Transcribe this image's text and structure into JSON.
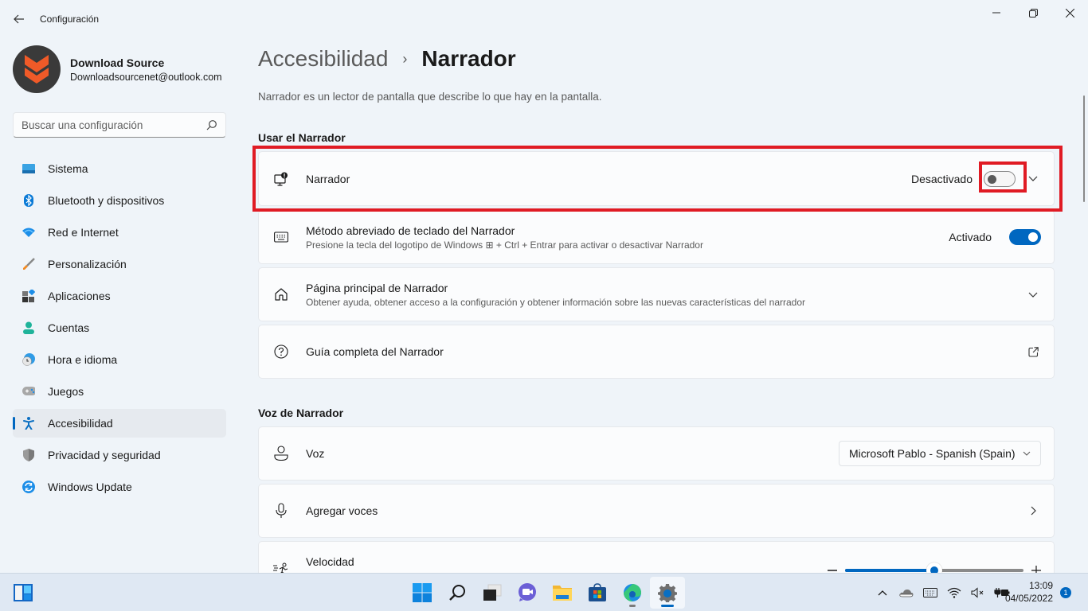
{
  "window": {
    "app_title": "Configuración",
    "icons": {
      "back": "arrow-left-icon",
      "minimize": "minimize-icon",
      "maximize": "restore-icon",
      "close": "close-icon"
    }
  },
  "profile": {
    "name": "Download Source",
    "email": "Downloadsourcenet@outlook.com"
  },
  "search": {
    "placeholder": "Buscar una configuración",
    "value": ""
  },
  "sidebar": {
    "items": [
      {
        "label": "Sistema",
        "icon": "system-display-icon",
        "active": false
      },
      {
        "label": "Bluetooth y dispositivos",
        "icon": "bluetooth-icon",
        "active": false
      },
      {
        "label": "Red e Internet",
        "icon": "wifi-icon",
        "active": false
      },
      {
        "label": "Personalización",
        "icon": "paintbrush-icon",
        "active": false
      },
      {
        "label": "Aplicaciones",
        "icon": "apps-icon",
        "active": false
      },
      {
        "label": "Cuentas",
        "icon": "account-icon",
        "active": false
      },
      {
        "label": "Hora e idioma",
        "icon": "time-language-icon",
        "active": false
      },
      {
        "label": "Juegos",
        "icon": "gamepad-icon",
        "active": false
      },
      {
        "label": "Accesibilidad",
        "icon": "accessibility-icon",
        "active": true
      },
      {
        "label": "Privacidad y seguridad",
        "icon": "shield-icon",
        "active": false
      },
      {
        "label": "Windows Update",
        "icon": "windows-update-icon",
        "active": false
      }
    ]
  },
  "main": {
    "breadcrumb_parent": "Accesibilidad",
    "breadcrumb_separator": "›",
    "page_title": "Narrador",
    "description": "Narrador es un lector de pantalla que describe lo que hay en la pantalla.",
    "sections": [
      {
        "title": "Usar el Narrador",
        "cards": [
          {
            "title": "Narrador",
            "state_label": "Desactivado",
            "toggle_on": false,
            "icon": "narrator-icon",
            "control": "toggle-expand"
          },
          {
            "title": "Método abreviado de teclado del Narrador",
            "subtitle": "Presione la tecla del logotipo de Windows ⊞ + Ctrl + Entrar para activar o desactivar Narrador",
            "state_label": "Activado",
            "toggle_on": true,
            "icon": "keyboard-icon",
            "control": "toggle"
          },
          {
            "title": "Página principal de Narrador",
            "subtitle": "Obtener ayuda, obtener acceso a la configuración y obtener información sobre las nuevas características del narrador",
            "icon": "home-icon",
            "control": "expand"
          },
          {
            "title": "Guía completa del Narrador",
            "icon": "help-circle-icon",
            "control": "external-link"
          }
        ]
      },
      {
        "title": "Voz de Narrador",
        "cards": [
          {
            "title": "Voz",
            "icon": "person-voice-icon",
            "control": "dropdown",
            "selected": "Microsoft Pablo - Spanish (Spain)"
          },
          {
            "title": "Agregar voces",
            "icon": "microphone-icon",
            "control": "chevron-right"
          },
          {
            "title": "Velocidad",
            "icon": "speed-icon",
            "control": "slider",
            "slider_value_percent": 50
          }
        ]
      }
    ]
  },
  "taskbar": {
    "apps": [
      {
        "name": "start",
        "icon": "windows-start-icon",
        "active": false,
        "running": false
      },
      {
        "name": "search",
        "icon": "search-icon",
        "active": false,
        "running": false
      },
      {
        "name": "task-view",
        "icon": "task-view-icon",
        "active": false,
        "running": false
      },
      {
        "name": "teams-chat",
        "icon": "chat-icon",
        "active": false,
        "running": false
      },
      {
        "name": "file-explorer",
        "icon": "folder-icon",
        "active": false,
        "running": false
      },
      {
        "name": "microsoft-store",
        "icon": "store-icon",
        "active": false,
        "running": false
      },
      {
        "name": "edge",
        "icon": "edge-icon",
        "active": false,
        "running": true
      },
      {
        "name": "settings",
        "icon": "gear-icon",
        "active": true,
        "running": true
      }
    ],
    "tray": [
      "chevron-up-icon",
      "onedrive-icon",
      "keyboard-icon",
      "wifi-icon",
      "volume-muted-icon",
      "battery-charging-icon"
    ],
    "time": "13:09",
    "date": "04/05/2022",
    "notification_count": "1"
  },
  "colors": {
    "accent": "#0067c0",
    "highlight": "#e01b24",
    "background": "#eff4f9",
    "card": "#fbfcfd"
  }
}
